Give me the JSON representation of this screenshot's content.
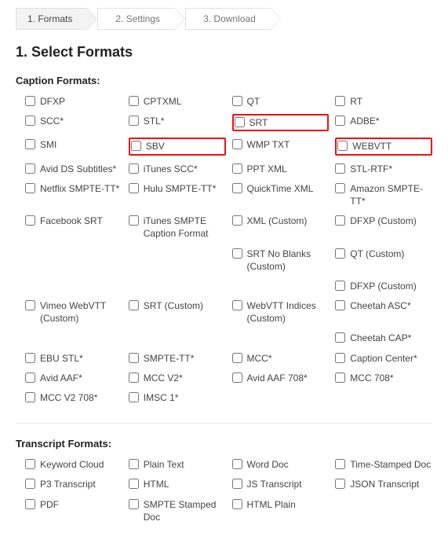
{
  "steps": [
    {
      "label": "1. Formats",
      "active": true
    },
    {
      "label": "2. Settings",
      "active": false
    },
    {
      "label": "3. Download",
      "active": false
    }
  ],
  "section_title": "1. Select Formats",
  "caption_group": {
    "title": "Caption Formats:",
    "items": [
      {
        "label": "DFXP"
      },
      {
        "label": "CPTXML"
      },
      {
        "label": "QT"
      },
      {
        "label": "RT"
      },
      {
        "label": "SCC*"
      },
      {
        "label": "STL*"
      },
      {
        "label": "SRT",
        "highlight": true
      },
      {
        "label": "ADBE*"
      },
      {
        "label": "SMI"
      },
      {
        "label": "SBV",
        "highlight": true
      },
      {
        "label": "WMP TXT"
      },
      {
        "label": "WEBVTT",
        "highlight": true
      },
      {
        "label": "Avid DS Subtitles*"
      },
      {
        "label": "iTunes SCC*"
      },
      {
        "label": "PPT XML"
      },
      {
        "label": "STL-RTF*"
      },
      {
        "label": "Netflix SMPTE-TT*"
      },
      {
        "label": "Hulu SMPTE-TT*"
      },
      {
        "label": "QuickTime XML"
      },
      {
        "label": "Amazon SMPTE-TT*"
      },
      {
        "label": "Facebook SRT"
      },
      {
        "label": "iTunes SMPTE Caption Format"
      },
      {
        "label": "XML (Custom)"
      },
      {
        "label": "DFXP (Custom)"
      },
      {
        "empty": true
      },
      {
        "empty": true
      },
      {
        "label": "SRT No Blanks (Custom)"
      },
      {
        "label": "QT (Custom)"
      },
      {
        "empty": true
      },
      {
        "empty": true
      },
      {
        "empty": true
      },
      {
        "label": "DFXP (Custom)"
      },
      {
        "label": "Vimeo WebVTT (Custom)"
      },
      {
        "label": "SRT (Custom)"
      },
      {
        "label": "WebVTT Indices (Custom)"
      },
      {
        "label": "Cheetah ASC*"
      },
      {
        "empty": true
      },
      {
        "empty": true
      },
      {
        "empty": true
      },
      {
        "label": "Cheetah CAP*"
      },
      {
        "label": "EBU STL*"
      },
      {
        "label": "SMPTE-TT*"
      },
      {
        "label": "MCC*"
      },
      {
        "label": "Caption Center*"
      },
      {
        "label": "Avid AAF*"
      },
      {
        "label": "MCC V2*"
      },
      {
        "label": "Avid AAF 708*"
      },
      {
        "label": "MCC 708*"
      },
      {
        "label": "MCC V2 708*"
      },
      {
        "label": "IMSC 1*"
      },
      {
        "empty": true
      },
      {
        "empty": true
      }
    ]
  },
  "transcript_group": {
    "title": "Transcript Formats:",
    "items": [
      {
        "label": "Keyword Cloud"
      },
      {
        "label": "Plain Text"
      },
      {
        "label": "Word Doc"
      },
      {
        "label": "Time-Stamped Doc"
      },
      {
        "label": "P3 Transcript"
      },
      {
        "label": "HTML"
      },
      {
        "label": "JS Transcript"
      },
      {
        "label": "JSON Transcript"
      },
      {
        "label": "PDF"
      },
      {
        "label": "SMPTE Stamped Doc"
      },
      {
        "label": "HTML Plain"
      },
      {
        "empty": true
      }
    ]
  }
}
